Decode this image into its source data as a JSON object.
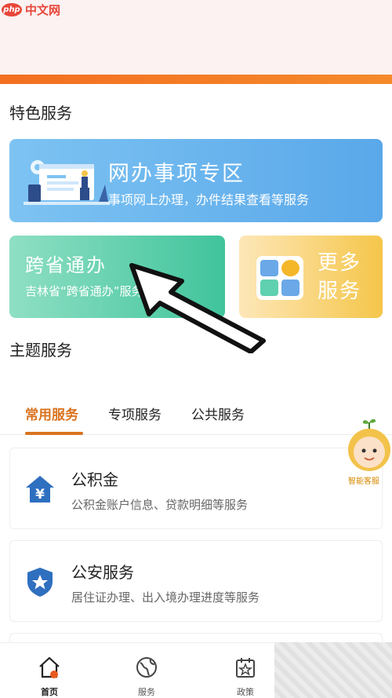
{
  "watermark": {
    "logo": "php",
    "text": "中文网"
  },
  "sections": {
    "featured_title": "特色服务",
    "theme_title": "主题服务"
  },
  "featured": {
    "online": {
      "title": "网办事项专区",
      "subtitle": "事项网上办理，办件结果查看等服务"
    },
    "cross_province": {
      "title": "跨省通办",
      "subtitle": "吉林省“跨省通办”服务专区"
    },
    "more": {
      "line1": "更多",
      "line2": "服务"
    }
  },
  "tabs": [
    {
      "label": "常用服务",
      "active": true
    },
    {
      "label": "专项服务",
      "active": false
    },
    {
      "label": "公共服务",
      "active": false
    }
  ],
  "services": [
    {
      "name": "公积金",
      "desc": "公积金账户信息、贷款明细等服务",
      "icon": "house-yen-icon"
    },
    {
      "name": "公安服务",
      "desc": "居住证办理、出入境办理进度等服务",
      "icon": "police-shield-icon"
    }
  ],
  "assistant": {
    "label": "智能客服"
  },
  "bottom_nav": [
    {
      "label": "首页",
      "icon": "home-icon",
      "active": true
    },
    {
      "label": "服务",
      "icon": "globe-icon",
      "active": false
    },
    {
      "label": "政策",
      "icon": "calendar-star-icon",
      "active": false
    }
  ],
  "colors": {
    "accent_orange": "#d9731f",
    "strip_orange": "#f36f21",
    "online_card": "#5aa8ea",
    "cross_card": "#40c49b",
    "more_card": "#f5c64a",
    "service_icon_blue": "#2f6fbf"
  }
}
